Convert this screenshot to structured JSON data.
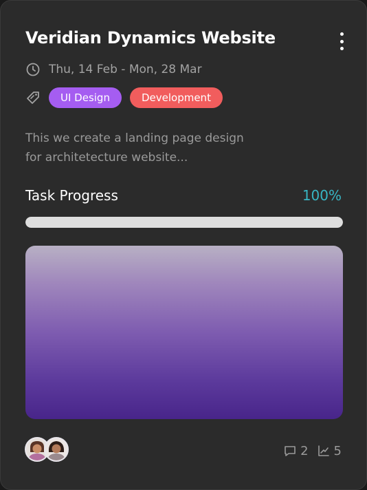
{
  "card": {
    "title": "Veridian Dynamics Website",
    "date_range": "Thu, 14 Feb - Mon, 28 Mar",
    "tags": [
      {
        "label": "UI Design",
        "color": "#a55df1"
      },
      {
        "label": "Development",
        "color": "#f15d5d"
      }
    ],
    "description_line1": "This we create a landing page design",
    "description_line2": "for architetecture website...",
    "progress": {
      "label": "Task Progress",
      "value_text": "100%",
      "fraction": 1.0
    },
    "stats": {
      "comments": "2",
      "activity": "5"
    },
    "icons": {
      "menu": "more-vertical-icon",
      "date": "clock-icon",
      "tags": "tag-icon",
      "comments": "comment-icon",
      "activity": "trend-up-icon"
    },
    "colors": {
      "card_background": "#2b2b2b",
      "progress_accent": "#38b6c4",
      "progress_fill": "#dedede"
    }
  }
}
